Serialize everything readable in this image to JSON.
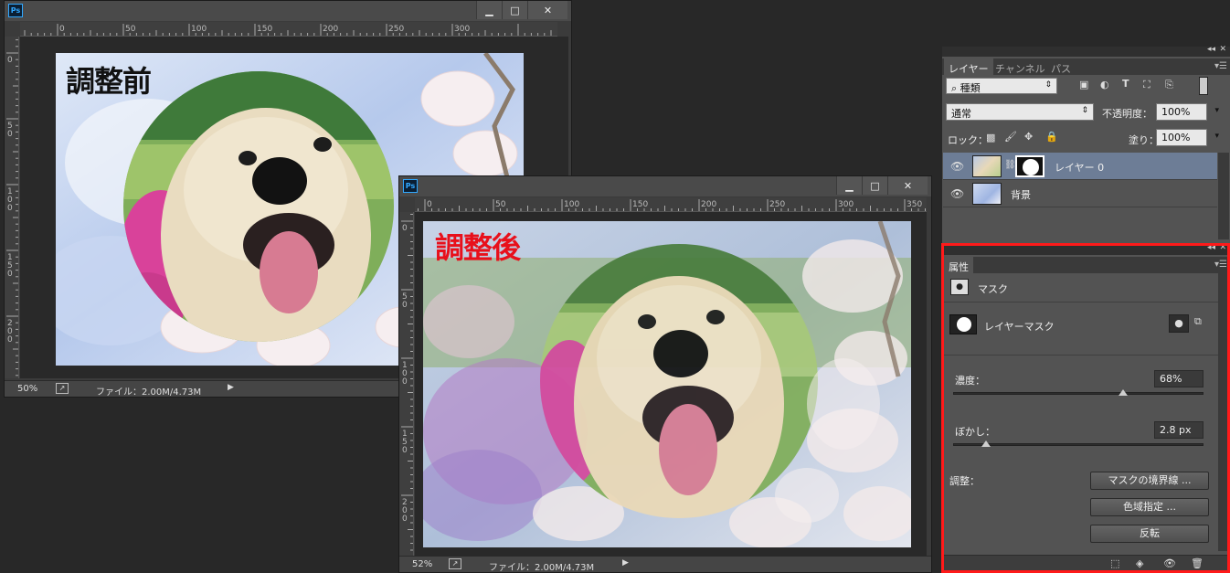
{
  "doc_before": {
    "app_badge": "Ps",
    "overlay_label": "調整前",
    "ruler_top": [
      "0",
      "50",
      "100",
      "150",
      "200",
      "250",
      "300"
    ],
    "ruler_left": [
      "0",
      "5 0",
      "1 0 0",
      "1 5 0",
      "2 0 0"
    ],
    "zoom": "50%",
    "file_info": "ファイル：2.00M/4.73M"
  },
  "doc_after": {
    "app_badge": "Ps",
    "overlay_label": "調整後",
    "ruler_top": [
      "0",
      "50",
      "100",
      "150",
      "200",
      "250",
      "300",
      "350"
    ],
    "ruler_left": [
      "0",
      "5 0",
      "1 0 0",
      "1 5 0",
      "2 0 0"
    ],
    "zoom": "52%",
    "file_info": "ファイル：2.00M/4.73M"
  },
  "window_controls": {
    "minimize": "▁",
    "maximize": "□",
    "close": "✕"
  },
  "layers_panel": {
    "tabs": [
      "レイヤー",
      "チャンネル",
      "パス"
    ],
    "filter_label": "種類",
    "blend_mode": "通常",
    "opacity_label": "不透明度：",
    "opacity_value": "100%",
    "lock_label": "ロック：",
    "fill_label": "塗り：",
    "fill_value": "100%",
    "layers": [
      {
        "name": "レイヤー 0",
        "selected": true
      },
      {
        "name": "背景",
        "selected": false
      }
    ]
  },
  "properties_panel": {
    "tab": "属性",
    "section_title": "マスク",
    "mask_label": "レイヤーマスク",
    "density_label": "濃度：",
    "density_value": "68%",
    "density_fraction": 0.68,
    "feather_label": "ぼかし：",
    "feather_value": "2.8 px",
    "feather_fraction": 0.014,
    "refine_label": "調整：",
    "buttons": [
      "マスクの境界線 ...",
      "色域指定 ...",
      "反転"
    ]
  },
  "colors": {
    "selected_layer": "#6d7d96",
    "highlight_box": "#ff1a1a",
    "after_label": "#e8101b"
  }
}
